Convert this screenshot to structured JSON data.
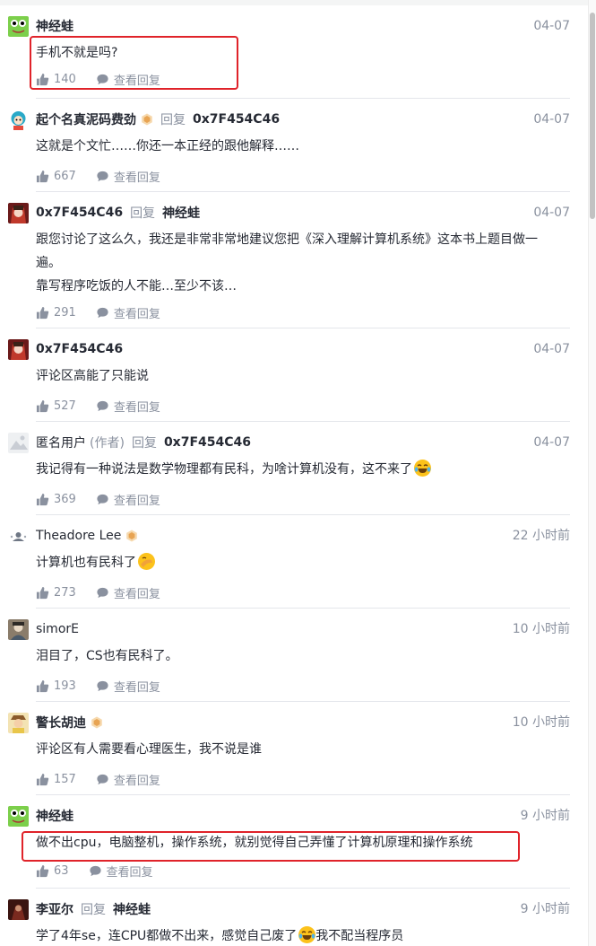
{
  "actions": {
    "reply_view": "查看回复",
    "reply_word": "回复"
  },
  "colors": {
    "highlight_border": "#e0232a",
    "muted": "#8a919f",
    "text": "#252933"
  },
  "comments": [
    {
      "user": "神经蛙",
      "time": "04-07",
      "lines": [
        "手机不就是吗?"
      ],
      "likes": "140"
    },
    {
      "user": "起个名真泥码费劲",
      "reply_to": "0x7F454C46",
      "time": "04-07",
      "lines": [
        "这就是个文忙……你还一本正经的跟他解释……"
      ],
      "likes": "667"
    },
    {
      "user": "0x7F454C46",
      "reply_to": "神经蛙",
      "time": "04-07",
      "lines": [
        "跟您讨论了这么久，我还是非常非常地建议您把《深入理解计算机系统》这本书上题目做一",
        "遍。",
        "靠写程序吃饭的人不能…至少不该…"
      ],
      "likes": "291"
    },
    {
      "user": "0x7F454C46",
      "time": "04-07",
      "lines": [
        "评论区高能了只能说"
      ],
      "likes": "527"
    },
    {
      "user": "匿名用户",
      "author_tag": "(作者)",
      "reply_to": "0x7F454C46",
      "time": "04-07",
      "lines": [
        "我记得有一种说法是数学物理都有民科，为啥计算机没有，这不来了"
      ],
      "likes": "369"
    },
    {
      "user": "Theadore Lee",
      "time": "22 小时前",
      "lines": [
        "计算机也有民科了"
      ],
      "likes": "273"
    },
    {
      "user": "simorE",
      "time": "10 小时前",
      "lines": [
        "泪目了，CS也有民科了。"
      ],
      "likes": "193"
    },
    {
      "user": "警长胡迪",
      "time": "10 小时前",
      "lines": [
        "评论区有人需要看心理医生，我不说是谁"
      ],
      "likes": "157"
    },
    {
      "user": "神经蛙",
      "time": "9 小时前",
      "lines": [
        "做不出cpu，电脑整机，操作系统，就别觉得自己弄懂了计算机原理和操作系统"
      ],
      "likes": "63"
    },
    {
      "user": "李亚尔",
      "reply_to": "神经蛙",
      "time": "9 小时前",
      "lines": [
        "学了4年se，连CPU都做不出来，感觉自己废了",
        "我不配当程序员"
      ]
    }
  ]
}
